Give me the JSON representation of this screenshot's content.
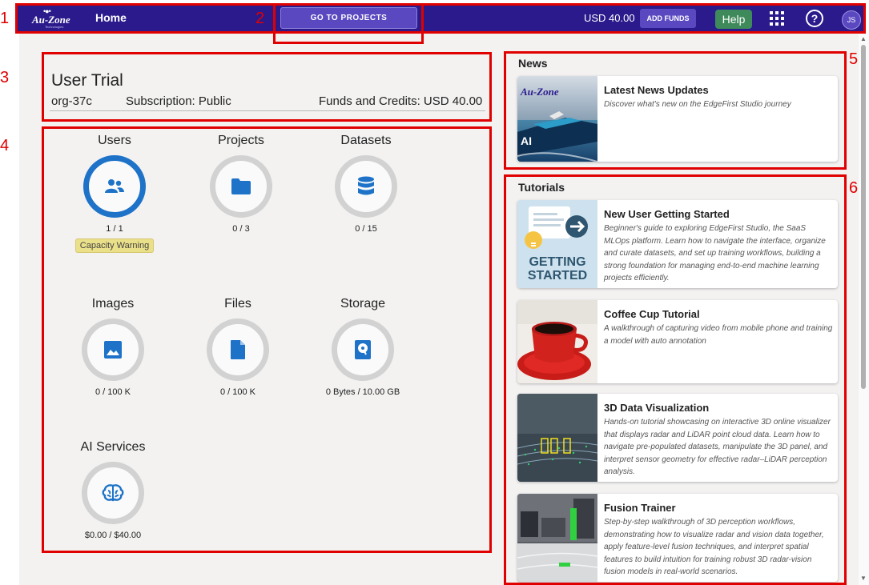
{
  "topbar": {
    "logo_text": "Au-Zone",
    "logo_sub": "Technologies",
    "home_label": "Home",
    "goto_projects_label": "GO TO PROJECTS",
    "balance": "USD 40.00",
    "add_funds_label": "ADD FUNDS",
    "help_label": "Help",
    "avatar_initials": "JS",
    "icons": [
      "apps-grid-icon",
      "help-circle-icon"
    ]
  },
  "annotations": [
    "1",
    "2",
    "3",
    "4",
    "5",
    "6"
  ],
  "org": {
    "title": "User Trial",
    "id": "org-37c",
    "subscription": "Subscription: Public",
    "funds": "Funds and Credits: USD 40.00"
  },
  "stats": [
    {
      "label": "Users",
      "value": "1 / 1",
      "icon": "users-icon",
      "badge": "Capacity Warning",
      "fill": 1.0
    },
    {
      "label": "Projects",
      "value": "0 / 3",
      "icon": "folder-icon",
      "fill": 0
    },
    {
      "label": "Datasets",
      "value": "0 / 15",
      "icon": "database-icon",
      "fill": 0
    },
    {
      "label": "Images",
      "value": "0 / 100 K",
      "icon": "image-icon",
      "fill": 0
    },
    {
      "label": "Files",
      "value": "0 / 100 K",
      "icon": "file-icon",
      "fill": 0
    },
    {
      "label": "Storage",
      "value": "0 Bytes / 10.00 GB",
      "icon": "hard-drive-icon",
      "fill": 0
    },
    {
      "label": "AI Services",
      "value": "$0.00 / $40.00",
      "icon": "brain-icon",
      "fill": 0
    }
  ],
  "news": {
    "title": "News",
    "items": [
      {
        "title": "Latest News Updates",
        "desc": "Discover what's new on the EdgeFirst Studio journey"
      }
    ]
  },
  "tutorials": {
    "title": "Tutorials",
    "items": [
      {
        "title": "New User Getting Started",
        "desc": "Beginner's guide to exploring EdgeFirst Studio, the SaaS MLOps platform. Learn how to navigate the interface, organize and curate datasets, and set up training workflows, building a strong foundation for managing end-to-end machine learning projects efficiently.",
        "thumb_text": "GETTING STARTED"
      },
      {
        "title": "Coffee Cup Tutorial",
        "desc": "A walkthrough of capturing video from mobile phone and training a model with auto annotation"
      },
      {
        "title": "3D Data Visualization",
        "desc": "Hands-on tutorial showcasing on interactive 3D online visualizer that displays radar and LiDAR point cloud data. Learn how to navigate pre-populated datasets, manipulate the 3D panel, and interpret sensor geometry for effective radar–LiDAR perception analysis."
      },
      {
        "title": "Fusion Trainer",
        "desc": "Step-by-step walkthrough of 3D perception workflows, demonstrating how to visualize radar and vision data together, apply feature-level fusion techniques, and interpret spatial features to build intuition for training robust 3D radar-vision fusion models in real-world scenarios."
      }
    ]
  },
  "colors": {
    "topbar": "#2a1a8c",
    "accent": "#1e73c8",
    "annotation": "#e00000",
    "help": "#3f8a5a",
    "warning": "#ebe08a"
  }
}
